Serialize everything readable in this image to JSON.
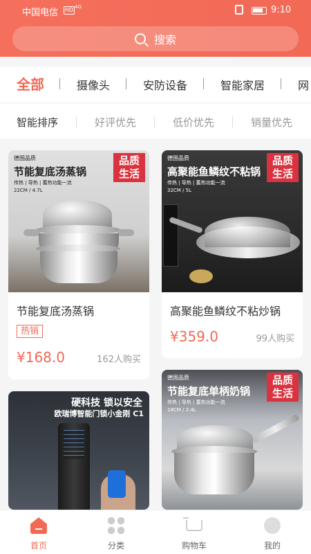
{
  "status_bar": {
    "carrier": "中国电信",
    "hd": "HD",
    "signal": "4G",
    "time": "9:10"
  },
  "search": {
    "label": "搜索",
    "icon": "search-icon"
  },
  "categories": [
    {
      "label": "全部",
      "active": true
    },
    {
      "label": "摄像头",
      "active": false
    },
    {
      "label": "安防设备",
      "active": false
    },
    {
      "label": "智能家居",
      "active": false
    },
    {
      "label": "网",
      "active": false
    }
  ],
  "sort_options": [
    {
      "label": "智能排序",
      "active": true
    },
    {
      "label": "好评优先",
      "active": false
    },
    {
      "label": "低价优先",
      "active": false
    },
    {
      "label": "销量优先",
      "active": false
    }
  ],
  "products": [
    {
      "image": {
        "brand": "德国品质",
        "slogan": "节能复底汤蒸锅",
        "spec_line1": "传热 | 导热 | 蓄热功能一流",
        "spec_line2": "22CM / 4.7L",
        "badge": "品质\n生活"
      },
      "title": "节能复底汤蒸锅",
      "tag": "热销",
      "price": "¥168.0",
      "sold": "162人购买"
    },
    {
      "image": {
        "brand": "德国品质",
        "slogan": "高聚能鱼鳞纹不粘锅",
        "spec_line1": "传热 | 导热 | 蓄热功能一流",
        "spec_line2": "32CM / 5L",
        "badge": "品质\n生活"
      },
      "title": "高聚能鱼鳞纹不粘炒锅",
      "price": "¥359.0",
      "sold": "99人购买"
    },
    {
      "image": {
        "slogan": "硬科技  锁以安全",
        "desc": "欧瑞博智能门锁小金刚  C1"
      }
    },
    {
      "image": {
        "brand": "德国品质",
        "slogan": "节能复底单柄奶锅",
        "spec_line1": "传热 | 导热 | 蓄热功能一流",
        "spec_line2": "18CM / 2.4L",
        "badge": "品质\n生活"
      }
    }
  ],
  "tab_bar": [
    {
      "label": "首页",
      "icon": "home-icon",
      "active": true
    },
    {
      "label": "分类",
      "icon": "category-icon",
      "active": false
    },
    {
      "label": "购物车",
      "icon": "cart-icon",
      "active": false
    },
    {
      "label": "我的",
      "icon": "profile-icon",
      "active": false
    }
  ],
  "colors": {
    "accent": "#f26956",
    "badge": "#d9333f"
  }
}
